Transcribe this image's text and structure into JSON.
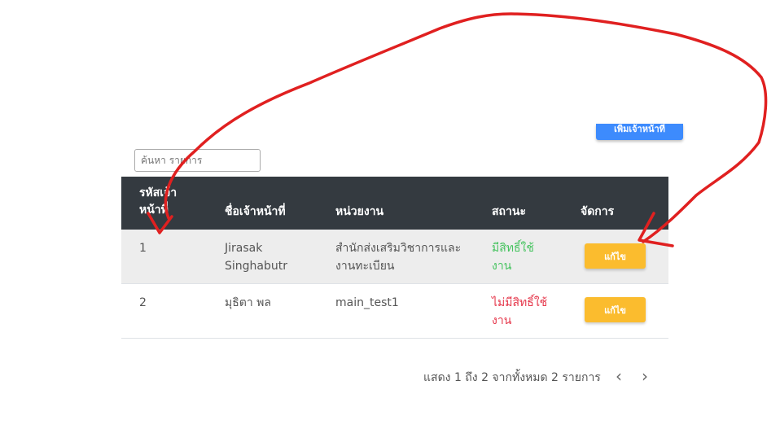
{
  "toolbar": {
    "add_staff_label": "เพิ่มเจ้าหน้าที่"
  },
  "search": {
    "placeholder": "ค้นหา รายการ"
  },
  "table": {
    "headers": {
      "code": "รหัสเจ้าหน้าที่",
      "name": "ชื่อเจ้าหน้าที่",
      "unit": "หน่วยงาน",
      "status": "สถานะ",
      "manage": "จัดการ"
    },
    "rows": [
      {
        "code": "1",
        "name": "Jirasak Singhabutr",
        "unit": "สำนักส่งเสริมวิชาการและงานทะเบียน",
        "status": "มีสิทธิ์ใช้งาน",
        "action": "แก้ไข"
      },
      {
        "code": "2",
        "name": "มุธิตา พล",
        "unit": "main_test1",
        "status": "ไม่มีสิทธิ์ใช้งาน",
        "action": "แก้ไข"
      }
    ]
  },
  "pagination": {
    "summary": "แสดง 1 ถึง 2 จากทั้งหมด 2 รายการ",
    "prev_icon": "chevron-left-icon",
    "next_icon": "chevron-right-icon"
  },
  "colors": {
    "header_bg": "#343a40",
    "primary": "#3d8bfd",
    "warning": "#fbbc2e",
    "status_active": "#46c35f",
    "status_inactive": "#e5364a",
    "annotation": "#e02020"
  }
}
